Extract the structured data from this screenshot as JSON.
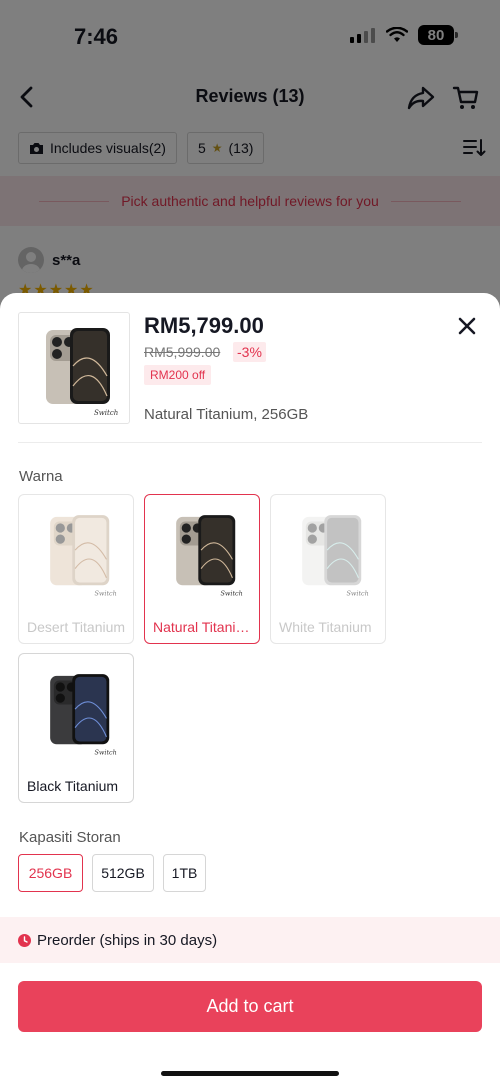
{
  "status": {
    "time": "7:46",
    "battery": "80"
  },
  "nav": {
    "title": "Reviews (13)"
  },
  "filters": {
    "visuals_chip": "Includes visuals(2)",
    "rating_chip_value": "5",
    "rating_chip_count": "(13)"
  },
  "banner": {
    "text": "Pick authentic and helpful reviews for you"
  },
  "review": {
    "username": "s**a",
    "stars": "★★★★★"
  },
  "product": {
    "price": "RM5,799.00",
    "original_price": "RM5,999.00",
    "discount": "-3%",
    "promo": "RM200 off",
    "selected_variant": "Natural Titanium, 256GB",
    "thumb_brand": "Switch"
  },
  "colour_section": {
    "label": "Warna",
    "options": [
      {
        "label": "Desert Titanium",
        "color": "#d8c9b8",
        "available": false,
        "selected": false
      },
      {
        "label": "Natural Titanium",
        "color": "#b8b1a6",
        "available": true,
        "selected": true
      },
      {
        "label": "White Titanium",
        "color": "#e6e6e4",
        "available": false,
        "selected": false
      },
      {
        "label": "Black Titanium",
        "color": "#3b3b3d",
        "available": true,
        "selected": false
      }
    ]
  },
  "storage_section": {
    "label": "Kapasiti Storan",
    "options": [
      {
        "label": "256GB",
        "selected": true
      },
      {
        "label": "512GB",
        "selected": false
      },
      {
        "label": "1TB",
        "selected": false
      }
    ]
  },
  "preorder": {
    "text": "Preorder (ships in 30 days)"
  },
  "cta": {
    "label": "Add to cart"
  },
  "colors": {
    "accent": "#e2334e",
    "button": "#e9425b",
    "star": "#f7b500"
  }
}
